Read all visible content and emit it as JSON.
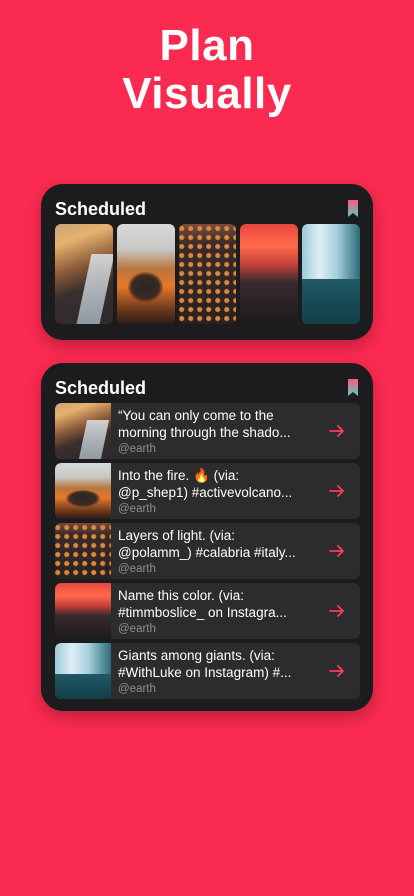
{
  "headline": {
    "line1": "Plan",
    "line2": "Visually"
  },
  "colors": {
    "background": "#fb2a50",
    "widget": "#1c1c1e",
    "row": "#2c2c2e",
    "arrow": "#ff3b5c"
  },
  "gallery_widget": {
    "title": "Scheduled",
    "icon": "bookmark-icon",
    "photos": [
      "coastal-cliff-photo",
      "volcano-crater-photo",
      "city-lights-night-photo",
      "red-sky-landscape-photo",
      "glacier-aerial-photo"
    ]
  },
  "list_widget": {
    "title": "Scheduled",
    "icon": "bookmark-icon",
    "items": [
      {
        "line1": "“You can only come to the",
        "line2": "morning through the shado...",
        "handle": "@earth",
        "action_icon": "arrow-right-icon"
      },
      {
        "line1": "Into the fire. 🔥 (via:",
        "line2": "@p_shep1) #activevolcano...",
        "handle": "@earth",
        "action_icon": "arrow-right-icon"
      },
      {
        "line1": "Layers of light. (via:",
        "line2": "@polamm_) #calabria #italy...",
        "handle": "@earth",
        "action_icon": "arrow-right-icon"
      },
      {
        "line1": "Name this color. (via:",
        "line2": "#timmboslice_ on Instagra...",
        "handle": "@earth",
        "action_icon": "arrow-right-icon"
      },
      {
        "line1": "Giants among giants. (via:",
        "line2": "#WithLuke on Instagram) #...",
        "handle": "@earth",
        "action_icon": "arrow-right-icon"
      }
    ]
  }
}
